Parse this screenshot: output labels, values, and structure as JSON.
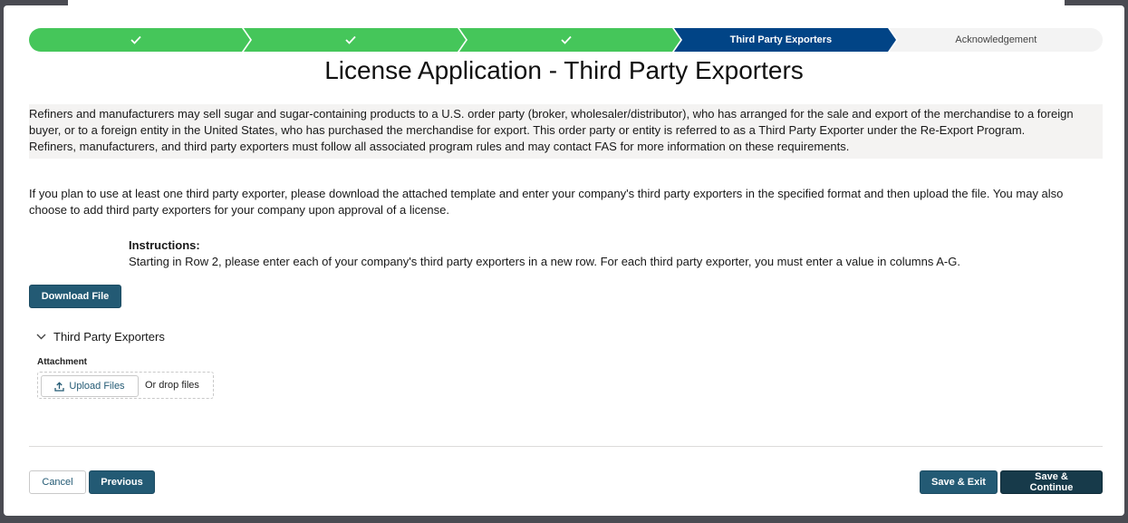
{
  "progress": {
    "steps": [
      {
        "label": "",
        "state": "done"
      },
      {
        "label": "",
        "state": "done"
      },
      {
        "label": "",
        "state": "done"
      },
      {
        "label": "Third Party Exporters",
        "state": "current"
      },
      {
        "label": "Acknowledgement",
        "state": "todo"
      }
    ]
  },
  "page": {
    "title": "License Application - Third Party Exporters"
  },
  "intro": {
    "paragraph_1": "Refiners and manufacturers may sell sugar and sugar-containing products to a U.S. order party (broker, wholesaler/distributor), who has arranged for the sale and export of the merchandise to a foreign buyer, or to a foreign entity in the United States, who has purchased the merchandise for export. This order party or entity is referred to as a Third Party Exporter under the Re-Export Program.",
    "paragraph_2": "Refiners, manufacturers, and third party exporters must follow all associated program rules and may contact FAS for more information on these requirements."
  },
  "body_text": "If you plan to use at least one third party exporter, please download the attached template and enter your company's third party exporters in the specified format and then upload the file. You may also choose to add third party exporters for your company upon approval of a license.",
  "instructions": {
    "heading": "Instructions:",
    "text": "Starting in Row 2, please enter each of your company's third party exporters in a new row. For each third party exporter, you must enter a value in columns A-G."
  },
  "download_button": "Download File",
  "section": {
    "title": "Third Party Exporters",
    "attachment_label": "Attachment",
    "upload_button": "Upload Files",
    "drop_text": "Or drop files"
  },
  "footer": {
    "cancel": "Cancel",
    "previous": "Previous",
    "save_exit": "Save & Exit",
    "save_continue": "Save & Continue"
  },
  "colors": {
    "step_done": "#45c65a",
    "step_current": "#014486",
    "brand_button": "#235a74",
    "dark_button": "#173a4a"
  },
  "icons": {
    "step_done": "check-icon",
    "section_toggle": "chevron-down-icon",
    "upload": "upload-icon"
  }
}
